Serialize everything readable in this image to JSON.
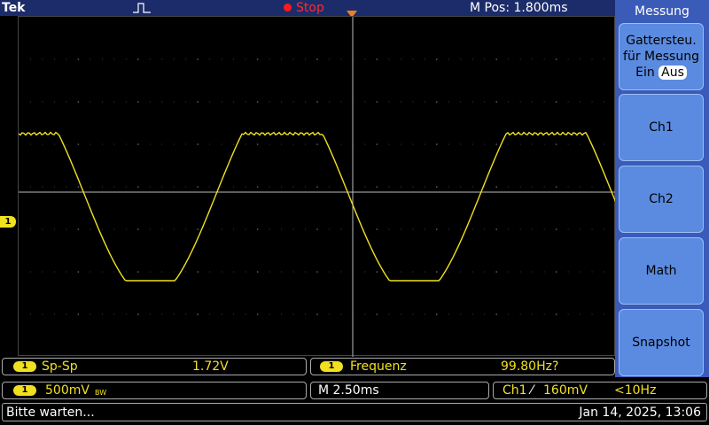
{
  "header": {
    "brand": "Tek",
    "run_status": "Stop",
    "m_pos": "M Pos: 1.800ms",
    "trigger_marker": "T"
  },
  "channel_marker": "1",
  "menu": {
    "title": "Messung",
    "buttons": [
      {
        "line1": "Gattersteu.",
        "line2": "für Messung",
        "line3_on": "Ein",
        "line3_off": "Aus"
      },
      {
        "label": "Ch1"
      },
      {
        "label": "Ch2"
      },
      {
        "label": "Math"
      },
      {
        "label": "Snapshot"
      }
    ]
  },
  "measurements": [
    {
      "channel": "1",
      "name": "Sp-Sp",
      "value": "1.72V"
    },
    {
      "channel": "1",
      "name": "Frequenz",
      "value": "99.80Hz?"
    }
  ],
  "scales": {
    "ch1": {
      "channel": "1",
      "volts": "500mV",
      "bw": "BW"
    },
    "time": "M 2.50ms",
    "trigger": {
      "source": "Ch1",
      "slope": "⁄",
      "level": "160mV",
      "freq": "<10Hz"
    }
  },
  "status": {
    "message": "Bitte warten...",
    "datetime": "Jan 14, 2025, 13:06"
  },
  "colors": {
    "trace": "#f0e020",
    "menu_bg": "#3a5bb8",
    "button_bg": "#5b8be0",
    "top_bar": "#1c2c6a",
    "stop": "#ff2a2a",
    "trigger": "#f08020"
  }
}
